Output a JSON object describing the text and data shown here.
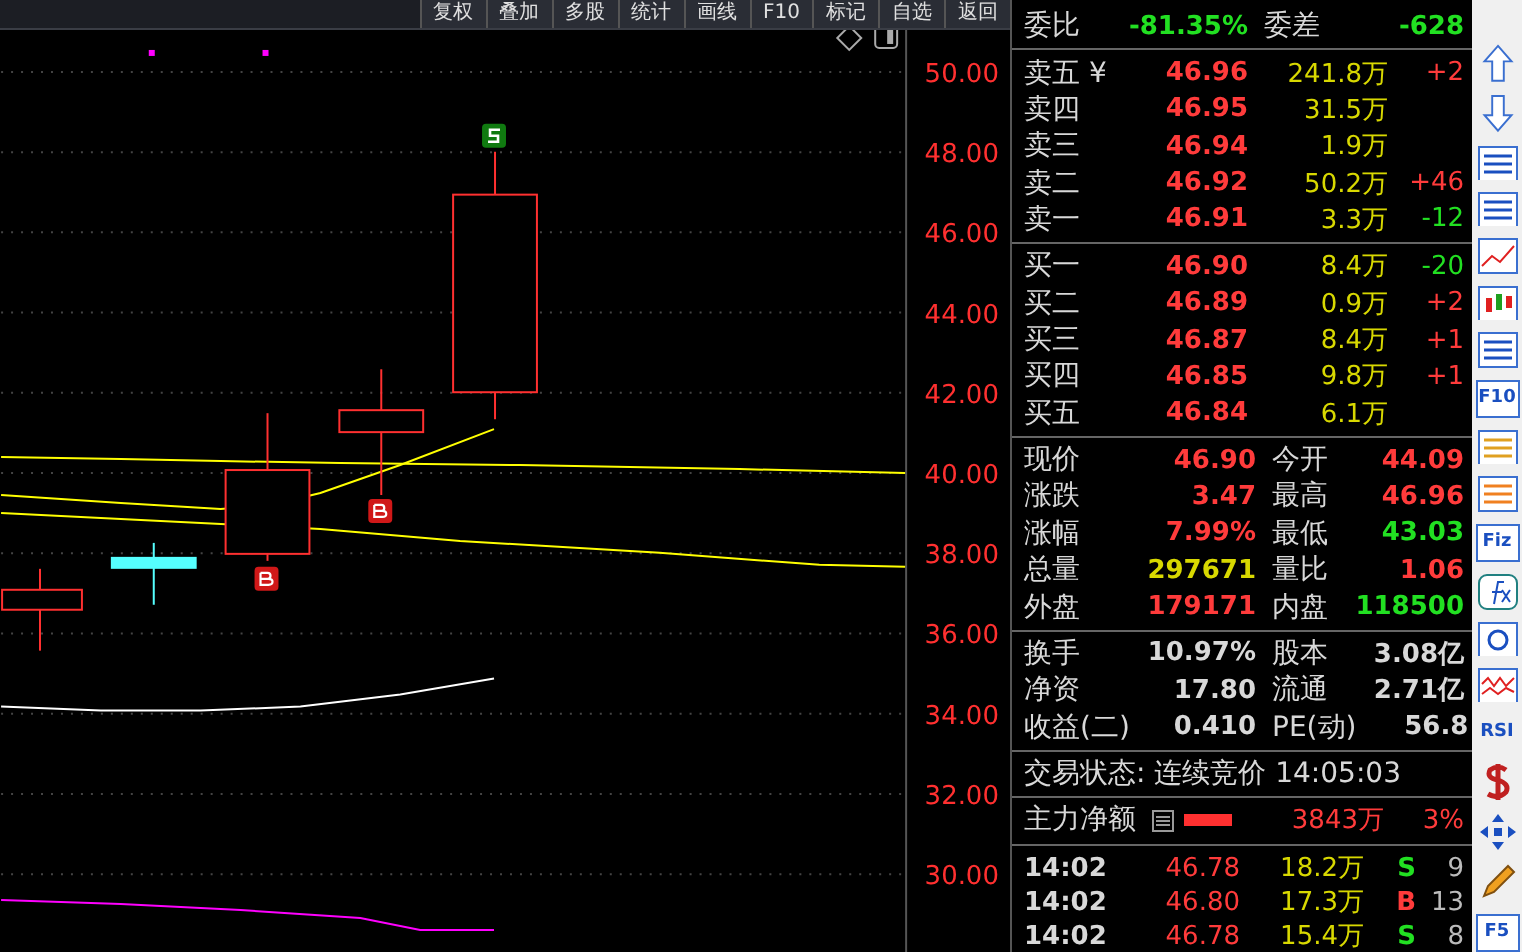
{
  "toolbar": [
    "复权",
    "叠加",
    "多股",
    "统计",
    "画线",
    "F10",
    "标记",
    "自选",
    "返回"
  ],
  "chart": {
    "y_axis_labels": [
      "50.00",
      "48.00",
      "46.00",
      "44.00",
      "42.00",
      "40.00",
      "38.00",
      "36.00",
      "34.00",
      "32.00",
      "30.00"
    ]
  },
  "summary": [
    {
      "label": "委比",
      "value": "-81.35%",
      "color": "#22e022"
    },
    {
      "label": "委差",
      "value": "-628",
      "color": "#22e022"
    }
  ],
  "asks": [
    {
      "label": "卖五",
      "marker": "¥",
      "price": "46.96",
      "volume": "241.8万",
      "change": "+2",
      "color": "#ff3b3b"
    },
    {
      "label": "卖四",
      "price": "46.95",
      "volume": "31.5万"
    },
    {
      "label": "卖三",
      "price": "46.94",
      "volume": "1.9万"
    },
    {
      "label": "卖二",
      "price": "46.92",
      "volume": "50.2万",
      "change": "+46",
      "color": "#ff3b3b"
    },
    {
      "label": "卖一",
      "price": "46.91",
      "volume": "3.3万",
      "change": "-12",
      "color": "#22e022"
    }
  ],
  "bids": [
    {
      "label": "买一",
      "price": "46.90",
      "volume": "8.4万",
      "change": "-20",
      "color": "#22e022"
    },
    {
      "label": "买二",
      "price": "46.89",
      "volume": "0.9万",
      "change": "+2",
      "color": "#ff3b3b"
    },
    {
      "label": "买三",
      "price": "46.87",
      "volume": "8.4万",
      "change": "+1",
      "color": "#ff3b3b"
    },
    {
      "label": "买四",
      "price": "46.85",
      "volume": "9.8万",
      "change": "+1",
      "color": "#ff3b3b"
    },
    {
      "label": "买五",
      "price": "46.84",
      "volume": "6.1万"
    }
  ],
  "quote": [
    {
      "label": "现价",
      "value": "46.90",
      "color": "#ff3b3b"
    },
    {
      "label": "今开",
      "value": "44.09",
      "color": "#ff3b3b"
    },
    {
      "label": "涨跌",
      "value": "3.47",
      "color": "#ff3b3b"
    },
    {
      "label": "最高",
      "value": "46.96",
      "color": "#ff3b3b"
    },
    {
      "label": "涨幅",
      "value": "7.99%",
      "color": "#ff3b3b"
    },
    {
      "label": "最低",
      "value": "43.03",
      "color": "#22e022"
    },
    {
      "label": "总量",
      "value": "297671",
      "color": "#d8d800"
    },
    {
      "label": "量比",
      "value": "1.06",
      "color": "#ff3b3b"
    },
    {
      "label": "外盘",
      "value": "179171",
      "color": "#ff3b3b"
    },
    {
      "label": "内盘",
      "value": "118500",
      "color": "#22e022"
    }
  ],
  "fundamentals": [
    {
      "label": "换手",
      "value": "10.97%"
    },
    {
      "label": "股本",
      "value": "3.08亿"
    },
    {
      "label": "净资",
      "value": "17.80"
    },
    {
      "label": "流通",
      "value": "2.71亿"
    },
    {
      "label": "收益(二)",
      "value": "0.410"
    },
    {
      "label": "PE(动)",
      "value": "56.8"
    }
  ],
  "trade_status": "交易状态: 连续竞价 14:05:03",
  "main_flow": {
    "label": "主力净额",
    "amount": "3843万",
    "percent": "3%"
  },
  "ticks": [
    {
      "time": "14:02",
      "price": "46.78",
      "volume": "18.2万",
      "side": "S",
      "kind": "sell",
      "count": "9"
    },
    {
      "time": "14:02",
      "price": "46.80",
      "volume": "17.3万",
      "side": "B",
      "kind": "buy",
      "count": "13"
    },
    {
      "time": "14:02",
      "price": "46.78",
      "volume": "15.4万",
      "side": "S",
      "kind": "sell",
      "count": "8"
    }
  ],
  "sidebar": [
    {
      "kind": "up"
    },
    {
      "kind": "down"
    },
    {
      "kind": "checklist"
    },
    {
      "kind": "table"
    },
    {
      "kind": "line"
    },
    {
      "kind": "candles"
    },
    {
      "kind": "windows"
    },
    {
      "kind": "text",
      "label": "F10"
    },
    {
      "kind": "tree"
    },
    {
      "kind": "doc"
    },
    {
      "kind": "text",
      "label": "Fiz"
    },
    {
      "kind": "fx"
    },
    {
      "kind": "circle"
    },
    {
      "kind": "wave"
    },
    {
      "kind": "plain",
      "label": "RSI"
    },
    {
      "kind": "dollar"
    },
    {
      "kind": "move"
    },
    {
      "kind": "pencil"
    },
    {
      "kind": "text",
      "label": "F5"
    }
  ]
}
